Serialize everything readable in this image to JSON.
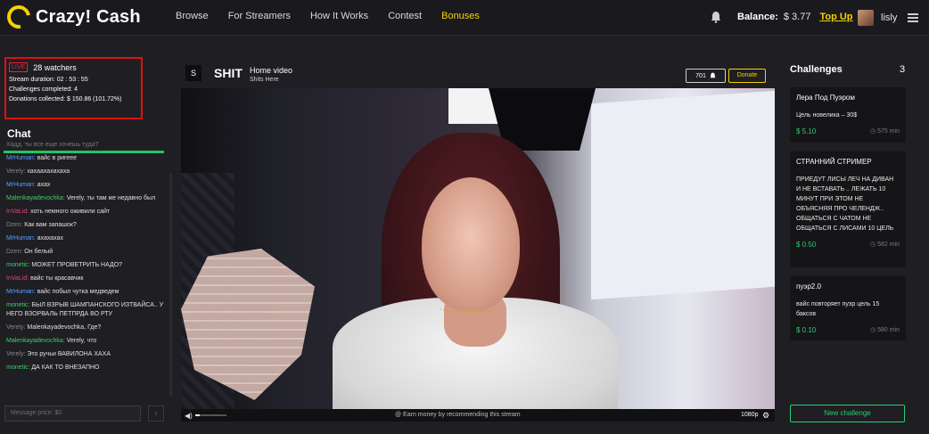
{
  "header": {
    "logo": "Crazy! Cash",
    "nav": [
      "Browse",
      "For Streamers",
      "How It Works",
      "Contest",
      "Bonuses"
    ],
    "balance_label": "Balance:",
    "balance_value": "$ 3.77",
    "topup_label": "Top Up",
    "username": "lisly"
  },
  "stats": {
    "live_badge": "LIVE",
    "watchers": "28 watchers",
    "duration": "Stream duration: 02 : 53 : 55",
    "challenges": "Challenges completed: 4",
    "donations": "Donations collected: $ 150.86 (101.72%)"
  },
  "chat": {
    "title": "Chat",
    "messages": [
      {
        "name": "",
        "text": "Хадд. ты все еще хочешь туда?",
        "name_style": "dim"
      },
      {
        "name": "MrHuman:",
        "text": "вайс в ригеее",
        "name_style": "blue"
      },
      {
        "name": "Verely:",
        "text": "хахаахахахаха",
        "name_style": "gray"
      },
      {
        "name": "MrHuman:",
        "text": "ахах",
        "name_style": "blue"
      },
      {
        "name": "Malenkayadevochka:",
        "text": "Verely, ты там же недавно был",
        "name_style": "green"
      },
      {
        "name": "InVaLid:",
        "text": "хоть немного оживили сайт",
        "name_style": "red"
      },
      {
        "name": "Dzen:",
        "text": "Как вам запашок?",
        "name_style": "gray"
      },
      {
        "name": "MrHuman:",
        "text": "ахахахах",
        "name_style": "blue"
      },
      {
        "name": "Dzen:",
        "text": "Он белый",
        "name_style": "gray"
      },
      {
        "name": "monetic:",
        "text": "МОЖЕТ ПРОВЕТРИТЬ НАДО?",
        "name_style": "green"
      },
      {
        "name": "InVaLid:",
        "text": "вайс ты красавчик",
        "name_style": "red"
      },
      {
        "name": "MrHuman:",
        "text": "вайс побыл чутка медведем",
        "name_style": "blue"
      },
      {
        "name": "monetic:",
        "text": "БЫЛ ВЗРЫВ ШАМПАНСКОГО ИЗТВАЙСА.. У НЕГО ВЗОРВАЛЬ ПЕТПРДА ВО РТУ",
        "name_style": "green"
      },
      {
        "name": "Verely:",
        "text": "Malenkayadevochka, Где?",
        "name_style": "gray"
      },
      {
        "name": "Malenkayadevochka:",
        "text": "Verely, что",
        "name_style": "green"
      },
      {
        "name": "Verely:",
        "text": "Это ручьи ВАВИЛОНА ХАХА",
        "name_style": "gray"
      },
      {
        "name": "monetic:",
        "text": "ДА КАК ТО ВНЕЗАПНО",
        "name_style": "green"
      }
    ],
    "input_placeholder": "Message price: $0",
    "send_icon": "↑"
  },
  "stream": {
    "icon_letter": "S",
    "title": "SHIT",
    "subtitle": "Home video",
    "subtitle2": "Shits Here",
    "viewers": "701",
    "donate_label": "Donate",
    "earn_text": "@ Earn money by recommending this stream",
    "quality": "1080p",
    "volume_fraction": 0.15
  },
  "challenges": {
    "title": "Challenges",
    "count": "3",
    "items": [
      {
        "title": "Лера Под Пуэром",
        "desc": "Цель новелика – 30$",
        "price": "$ 5.10",
        "time": "575 min"
      },
      {
        "title": "СТРАННИЙ СТРИМЕР",
        "desc": "ПРИЕДУТ ЛИСЫ ЛЕЧ НА ДИВАН И НЕ ВСТАВАТЬ .. ЛЕЖАТЬ 10 МИНУТ ПРИ ЭТОМ НЕ ОБЪЯСНЯЯ ПРО ЧЕЛЕНДЖ.. ОБЩАТЬСЯ С ЧАТОМ НЕ ОБЩАТЬСЯ С ЛИСАМИ 10 ЦЕЛЬ",
        "price": "$ 0.50",
        "time": "582 min"
      },
      {
        "title": "пуэр2.0",
        "desc": "вайс повторяет пуэр цель 15 баксов",
        "price": "$ 0.10",
        "time": "580 min"
      }
    ],
    "new_label": "New challenge"
  },
  "colors": {
    "accent": "#f5d100",
    "green": "#2ecc71",
    "live_red": "#e01010"
  }
}
